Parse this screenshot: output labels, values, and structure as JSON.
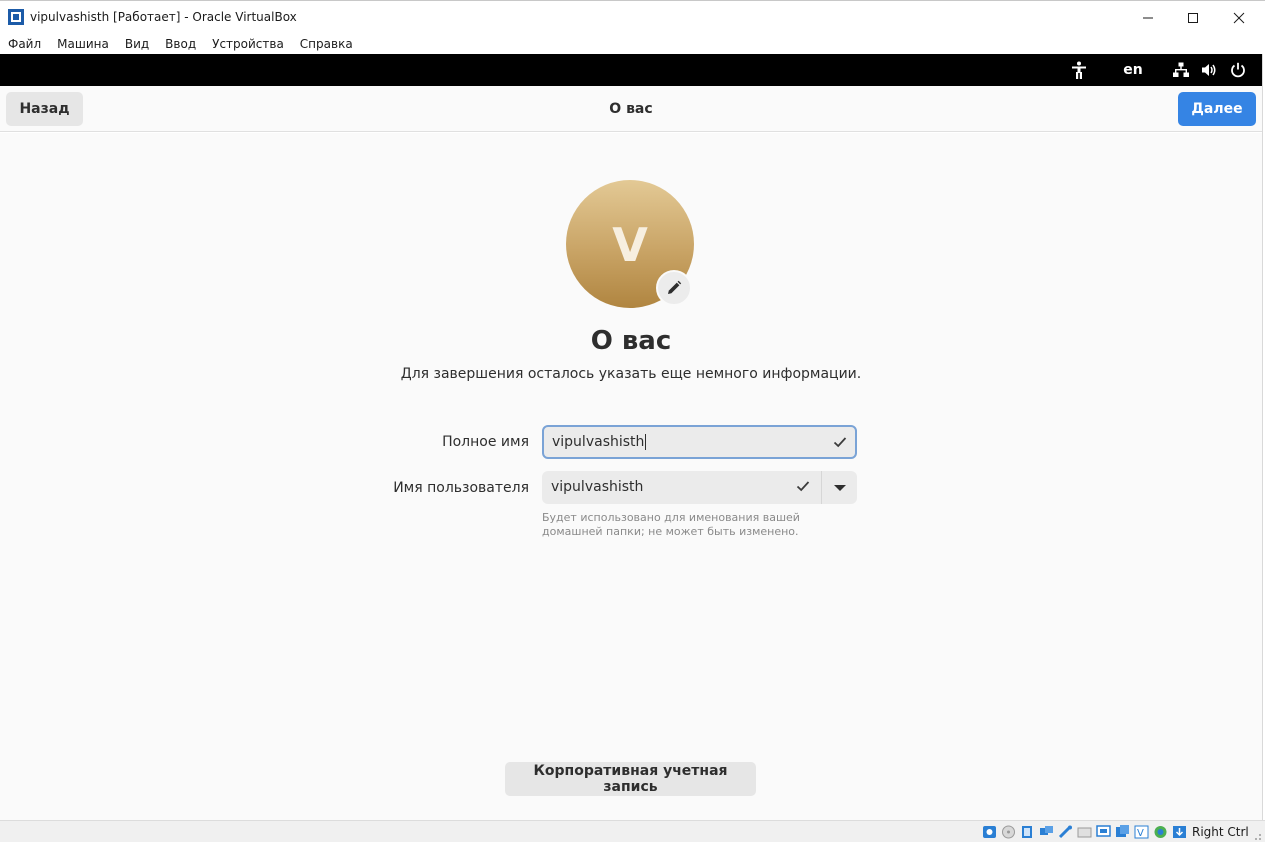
{
  "window": {
    "title": "vipulvashisth [Работает] - Oracle VirtualBox",
    "menu": [
      "Файл",
      "Машина",
      "Вид",
      "Ввод",
      "Устройства",
      "Справка"
    ]
  },
  "guest_topbar": {
    "language": "en"
  },
  "header": {
    "back_label": "Назад",
    "title": "О вас",
    "next_label": "Далее",
    "accent_color": "#3584e4"
  },
  "main": {
    "avatar_letter": "V",
    "heading": "О вас",
    "subtitle": "Для завершения осталось указать еще немного информации.",
    "fullname_label": "Полное имя",
    "fullname_value": "vipulvashisth",
    "username_label": "Имя пользователя",
    "username_value": "vipulvashisth",
    "username_hint": "Будет использовано для именования вашей домашней папки; не может быть изменено.",
    "enterprise_label": "Корпоративная учетная запись"
  },
  "statusbar": {
    "host_key": "Right Ctrl"
  }
}
